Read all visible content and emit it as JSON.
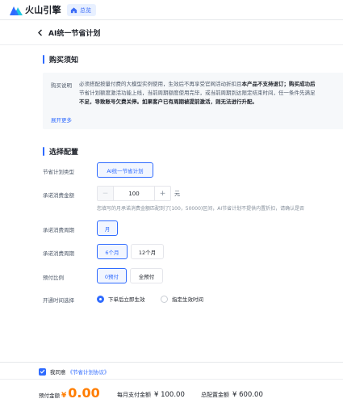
{
  "brand": {
    "name": "火山引擎",
    "logo_color": "#2f6bff"
  },
  "nav": {
    "home_tag": "总览",
    "home_icon": "home-icon"
  },
  "page": {
    "title": "AI统一节省计划",
    "back_icon": "chevron-left-icon"
  },
  "purchase_notice": {
    "section_title": "购买须知",
    "label": "购买说明",
    "lines": [
      {
        "normal": "必须搭配按量付费的大模型实例使用，生效后不再享受官网活动折扣且",
        "bold": "本产品不支持退订；购买成功后"
      },
      {
        "normal": "节省计划额度激活功能上线，当前周期额度使用完毕，或当前周期到达限定结束时间，任一条件先满足",
        "bold": ""
      },
      {
        "normal": "",
        "bold": "不足，导致账号欠费关停。如果客户已有周期被提前激活，则无法进行升配。"
      }
    ],
    "expand": "展开更多"
  },
  "config": {
    "section_title": "选择配置",
    "plan_type": {
      "label": "节省计划类型",
      "option": "AI统一节省计划"
    },
    "commit_amount": {
      "label": "承诺消费金额",
      "value": "100",
      "minus": "−",
      "plus": "+",
      "unit": "元",
      "hint": "您填写的月承诺消费金额匹配到了[100，50000)区间，AI节省计划不提供内置折扣，请确认是否"
    },
    "commit_cycle": {
      "label": "承诺消费周期",
      "option": "月"
    },
    "commit_duration": {
      "label": "承诺消费周期",
      "options": [
        "6个月",
        "12个月"
      ],
      "selected": "6个月"
    },
    "prepay_ratio": {
      "label": "预付比例",
      "options": [
        "0预付",
        "全预付"
      ],
      "selected": "0预付"
    },
    "activation": {
      "label": "开通时间选择",
      "options": [
        "下单后立即生效",
        "指定生效时间"
      ],
      "selected": "下单后立即生效"
    }
  },
  "footer": {
    "agree_text": "我同意",
    "agree_link": "《节省计划协议》",
    "prepay_label": "预付金额",
    "prepay_symbol": "¥",
    "prepay_value": "0.00",
    "monthly_label": "每月支付金额",
    "monthly_value": "¥ 100.00",
    "total_label": "总配置金额",
    "total_value": "¥ 600.00",
    "accent": "#ff7d00"
  }
}
